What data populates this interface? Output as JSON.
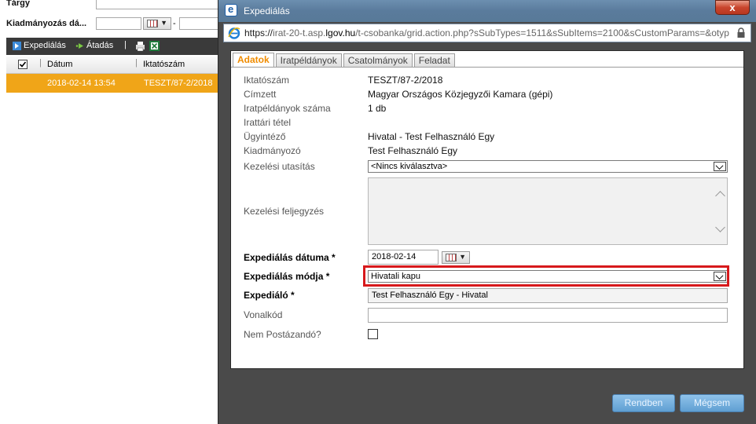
{
  "background": {
    "fields": {
      "subject_label": "Tárgy",
      "date_label": "Kiadmányozás dá...",
      "date_separator": "-"
    },
    "toolbar": {
      "expedialas": "Expediálás",
      "atadas": "Átadás",
      "separator": "|"
    },
    "grid": {
      "columns": [
        "Dátum",
        "Iktatószám"
      ],
      "row": {
        "datum": "2018-02-14 13:54",
        "iktatoszam": "TESZT/87-2/2018"
      }
    }
  },
  "window": {
    "title": "Expediálás",
    "close_glyph": "x",
    "url_proto": "https://",
    "url_host_prefix": "irat-20-t.asp.",
    "url_host": "lgov.hu",
    "url_path": "/t-csobanka/grid.action.php?sSubTypes=1511&sSubItems=2100&sCustomParams=&otyp"
  },
  "tabs": [
    "Adatok",
    "Iratpéldányok",
    "Csatolmányok",
    "Feladat"
  ],
  "form": {
    "iktatoszam_label": "Iktatószám",
    "iktatoszam": "TESZT/87-2/2018",
    "cimzett_label": "Címzett",
    "cimzett": "Magyar Országos Közjegyzői Kamara (gépi)",
    "peldanyok_label": "Iratpéldányok száma",
    "peldanyok": "1 db",
    "irattari_label": "Irattári tétel",
    "ugyintezo_label": "Ügyintéző",
    "ugyintezo": "Hivatal - Test Felhasználó Egy",
    "kiadmanyozo_label": "Kiadmányozó",
    "kiadmanyozo": "Test Felhasználó Egy",
    "kezelesi_utasitas_label": "Kezelési utasítás",
    "kezelesi_utasitas": "<Nincs kiválasztva>",
    "kezelesi_feljegyzes_label": "Kezelési feljegyzés",
    "exp_datum_label": "Expediálás dátuma *",
    "exp_datum": "2018-02-14",
    "exp_modja_label": "Expediálás módja *",
    "exp_modja": "Hivatali kapu",
    "expedialo_label": "Expediáló *",
    "expedialo": "Test Felhasználó Egy - Hivatal",
    "vonalkod_label": "Vonalkód",
    "nem_postazando_label": "Nem Postázandó?"
  },
  "buttons": {
    "ok": "Rendben",
    "cancel": "Mégsem"
  }
}
